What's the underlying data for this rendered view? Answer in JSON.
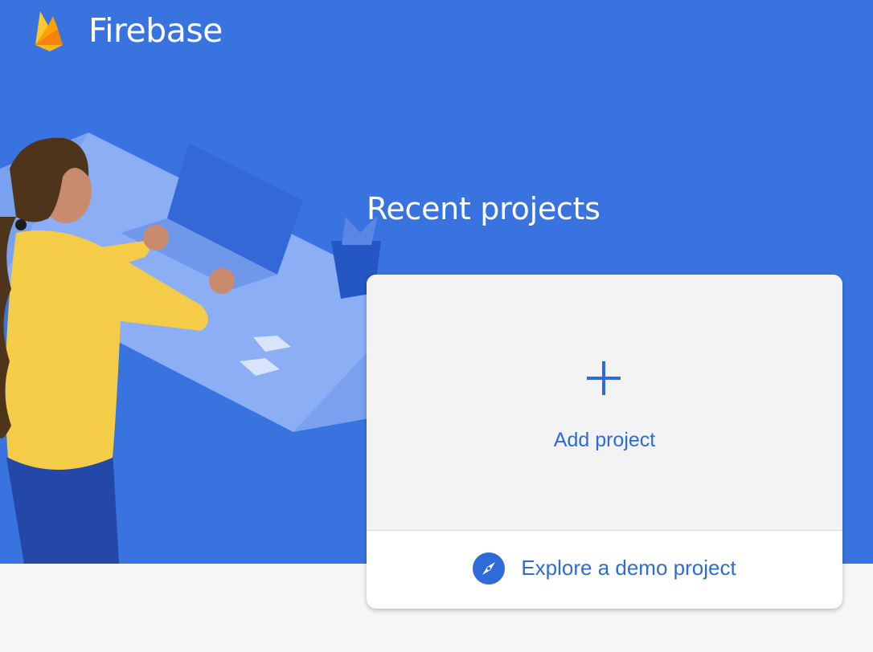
{
  "header": {
    "brand_name": "Firebase",
    "logo_icon": "firebase-flame-icon"
  },
  "main": {
    "section_title": "Recent projects",
    "add_project": {
      "label": "Add project",
      "icon": "plus-icon"
    },
    "demo_project": {
      "label": "Explore a demo project",
      "icon": "compass-icon"
    }
  },
  "colors": {
    "hero_background": "#3873e0",
    "page_background": "#f5f6f8",
    "accent_text": "#2f6bd6",
    "card_top": "#f3f3f4",
    "card_bottom": "#ffffff"
  }
}
